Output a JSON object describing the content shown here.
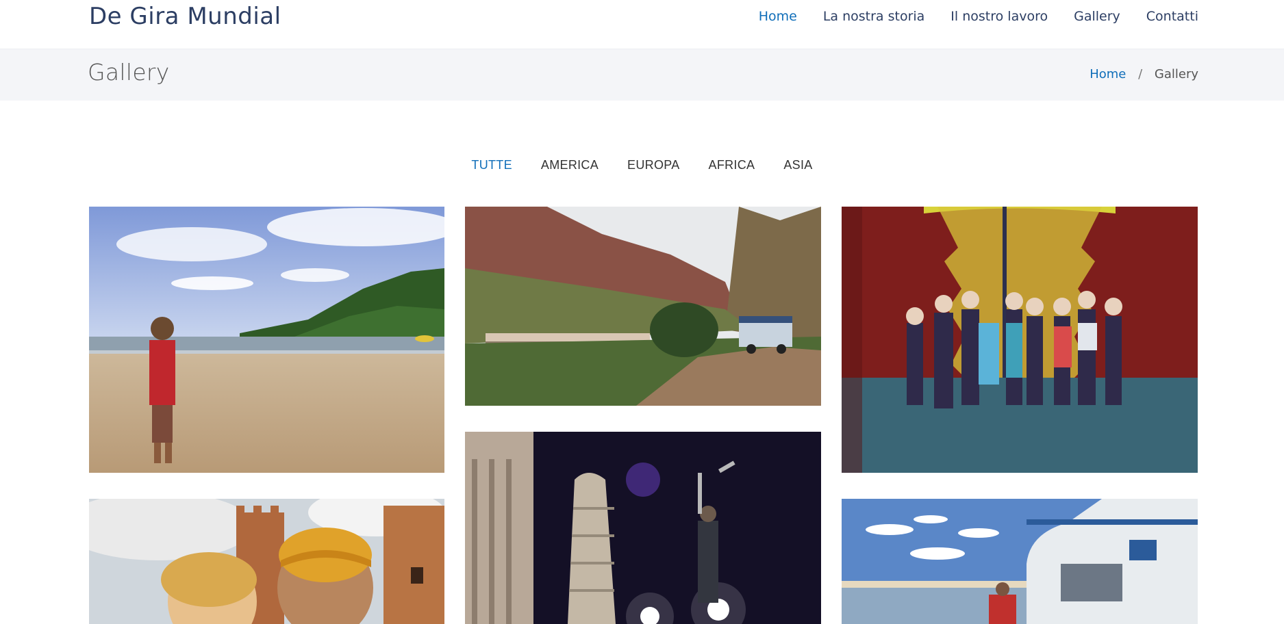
{
  "header": {
    "logo": "De Gira Mundial",
    "nav": [
      {
        "label": "Home",
        "active": true
      },
      {
        "label": "La nostra storia",
        "active": false
      },
      {
        "label": "Il nostro lavoro",
        "active": false
      },
      {
        "label": "Gallery",
        "active": false
      },
      {
        "label": "Contatti",
        "active": false
      }
    ]
  },
  "breadcrumbs": {
    "title": "Gallery",
    "home": "Home",
    "separator": "/",
    "current": "Gallery"
  },
  "filters": [
    {
      "label": "TUTTE",
      "active": true
    },
    {
      "label": "AMERICA",
      "active": false
    },
    {
      "label": "EUROPA",
      "active": false
    },
    {
      "label": "AFRICA",
      "active": false
    },
    {
      "label": "ASIA",
      "active": false
    }
  ],
  "colors": {
    "accent": "#106eb9",
    "heading": "#2c3e63",
    "band": "#f4f5f8"
  }
}
